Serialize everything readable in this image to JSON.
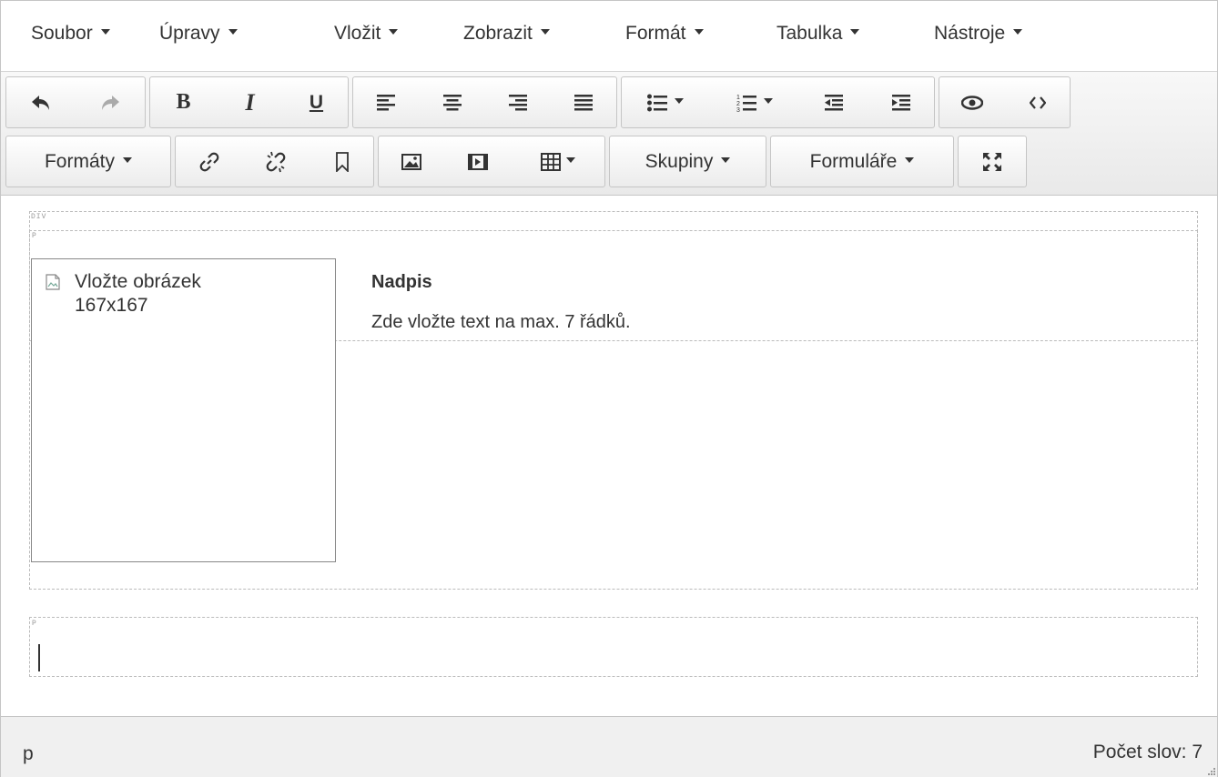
{
  "menubar": {
    "items": [
      {
        "label": "Soubor"
      },
      {
        "label": "Úpravy"
      },
      {
        "label": "Vložit"
      },
      {
        "label": "Zobrazit"
      },
      {
        "label": "Formát"
      },
      {
        "label": "Tabulka"
      },
      {
        "label": "Nástroje"
      }
    ]
  },
  "toolbar": {
    "formats_label": "Formáty",
    "groups_label": "Skupiny",
    "forms_label": "Formuláře",
    "icons": [
      "undo-icon",
      "redo-icon",
      "bold-icon",
      "italic-icon",
      "underline-icon",
      "align-left-icon",
      "align-center-icon",
      "align-right-icon",
      "align-justify-icon",
      "bullet-list-icon",
      "numbered-list-icon",
      "outdent-icon",
      "indent-icon",
      "preview-icon",
      "code-icon",
      "link-icon",
      "unlink-icon",
      "bookmark-icon",
      "image-icon",
      "media-icon",
      "table-icon",
      "fullscreen-icon"
    ],
    "bold_glyph": "B",
    "italic_glyph": "I",
    "underline_glyph": "U"
  },
  "content": {
    "div_tag": "DIV",
    "p_tag": "P",
    "image_placeholder_line1": "Vložte obrázek",
    "image_placeholder_line2": "167x167",
    "heading": "Nadpis",
    "body": "Zde vložte text na max. 7 řádků."
  },
  "statusbar": {
    "path": "p",
    "word_count": "Počet slov: 7"
  }
}
